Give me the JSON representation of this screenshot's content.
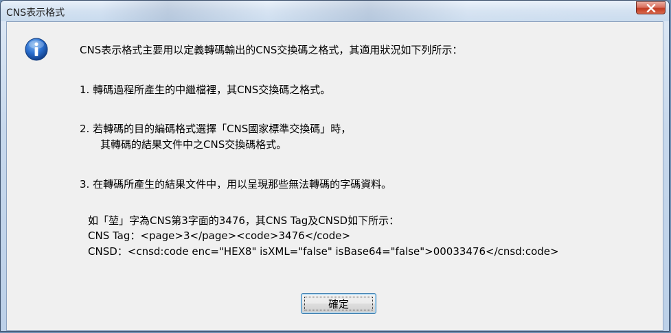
{
  "window": {
    "title": "CNS表示格式",
    "close_symbol": "X"
  },
  "message": {
    "intro": "CNS表示格式主要用以定義轉碼輸出的CNS交換碼之格式，其適用狀況如下列所示：",
    "item1": "1.   轉碼過程所產生的中繼檔裡，其CNS交換碼之格式。",
    "item2_line1": "2.   若轉碼的目的編碼格式選擇「CNS國家標準交換碼」時，",
    "item2_line2": "其轉碼的結果文件中之CNS交換碼格式。",
    "item3": "3.   在轉碼所產生的結果文件中，用以呈現那些無法轉碼的字碼資料。",
    "example_line1": "如「堃」字為CNS第3字面的3476，其CNS Tag及CNSD如下所示：",
    "example_line2": "CNS Tag：<page>3</page><code>3476</code>",
    "example_line3": "CNSD：<cnsd:code enc=\"HEX8\" isXML=\"false\" isBase64=\"false\">00033476</cnsd:code>"
  },
  "buttons": {
    "ok_label": "確定"
  },
  "icons": {
    "info": "info-icon",
    "close": "close-icon"
  },
  "colors": {
    "info_icon_blue": "#1f5fbf",
    "close_red": "#c23b22",
    "dialog_bg": "#f0f0f0"
  }
}
